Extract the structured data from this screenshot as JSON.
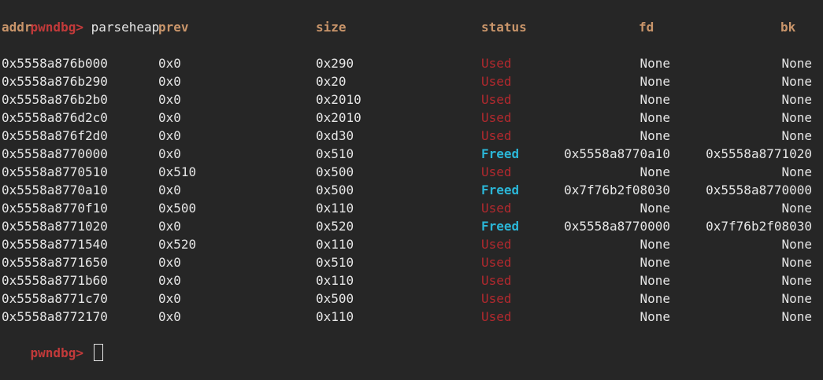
{
  "prompt": "pwndbg>",
  "command": "parseheap",
  "headers": {
    "addr": "addr",
    "prev": "prev",
    "size": "size",
    "status": "status",
    "fd": "fd",
    "bk": "bk"
  },
  "rows": [
    {
      "addr": "0x5558a876b000",
      "prev": "0x0",
      "size": "0x290",
      "status": "Used",
      "fd": "None",
      "bk": "None"
    },
    {
      "addr": "0x5558a876b290",
      "prev": "0x0",
      "size": "0x20",
      "status": "Used",
      "fd": "None",
      "bk": "None"
    },
    {
      "addr": "0x5558a876b2b0",
      "prev": "0x0",
      "size": "0x2010",
      "status": "Used",
      "fd": "None",
      "bk": "None"
    },
    {
      "addr": "0x5558a876d2c0",
      "prev": "0x0",
      "size": "0x2010",
      "status": "Used",
      "fd": "None",
      "bk": "None"
    },
    {
      "addr": "0x5558a876f2d0",
      "prev": "0x0",
      "size": "0xd30",
      "status": "Used",
      "fd": "None",
      "bk": "None"
    },
    {
      "addr": "0x5558a8770000",
      "prev": "0x0",
      "size": "0x510",
      "status": "Freed",
      "fd": "0x5558a8770a10",
      "bk": "0x5558a8771020"
    },
    {
      "addr": "0x5558a8770510",
      "prev": "0x510",
      "size": "0x500",
      "status": "Used",
      "fd": "None",
      "bk": "None"
    },
    {
      "addr": "0x5558a8770a10",
      "prev": "0x0",
      "size": "0x500",
      "status": "Freed",
      "fd": "0x7f76b2f08030",
      "bk": "0x5558a8770000"
    },
    {
      "addr": "0x5558a8770f10",
      "prev": "0x500",
      "size": "0x110",
      "status": "Used",
      "fd": "None",
      "bk": "None"
    },
    {
      "addr": "0x5558a8771020",
      "prev": "0x0",
      "size": "0x520",
      "status": "Freed",
      "fd": "0x5558a8770000",
      "bk": "0x7f76b2f08030"
    },
    {
      "addr": "0x5558a8771540",
      "prev": "0x520",
      "size": "0x110",
      "status": "Used",
      "fd": "None",
      "bk": "None"
    },
    {
      "addr": "0x5558a8771650",
      "prev": "0x0",
      "size": "0x510",
      "status": "Used",
      "fd": "None",
      "bk": "None"
    },
    {
      "addr": "0x5558a8771b60",
      "prev": "0x0",
      "size": "0x110",
      "status": "Used",
      "fd": "None",
      "bk": "None"
    },
    {
      "addr": "0x5558a8771c70",
      "prev": "0x0",
      "size": "0x500",
      "status": "Used",
      "fd": "None",
      "bk": "None"
    },
    {
      "addr": "0x5558a8772170",
      "prev": "0x0",
      "size": "0x110",
      "status": "Used",
      "fd": "None",
      "bk": "None"
    }
  ],
  "colors": {
    "background": "#262626",
    "prompt": "#c23a3a",
    "header": "#c9956a",
    "used": "#b3292e",
    "freed": "#2bb5d6",
    "text": "#e6e6e6"
  }
}
